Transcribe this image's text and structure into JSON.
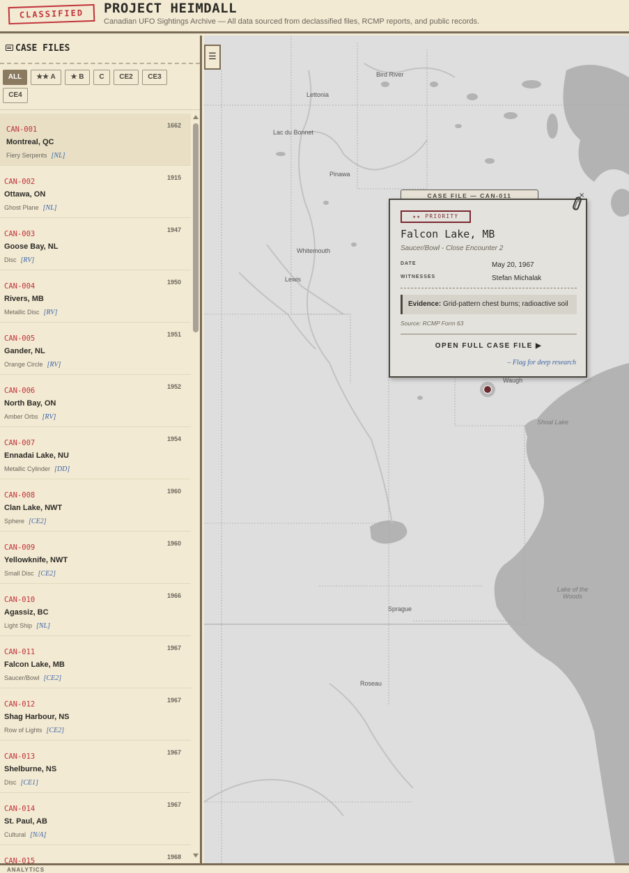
{
  "header": {
    "stamp": "CLASSIFIED",
    "title": "PROJECT HEIMDALL",
    "subtitle": "Canadian UFO Sightings Archive — All data sourced from declassified files, RCMP reports, and public records."
  },
  "sidebar": {
    "title": "CASE FILES",
    "filters": [
      "ALL",
      "★★ A",
      "★ B",
      "C",
      "CE2",
      "CE3",
      "CE4"
    ],
    "active_filter": "ALL",
    "cases": [
      {
        "code": "CAN-001",
        "year": "1662",
        "location": "Montreal, QC",
        "shape": "Fiery Serpents",
        "classification": "[NL]"
      },
      {
        "code": "CAN-002",
        "year": "1915",
        "location": "Ottawa, ON",
        "shape": "Ghost Plane",
        "classification": "[NL]"
      },
      {
        "code": "CAN-003",
        "year": "1947",
        "location": "Goose Bay, NL",
        "shape": "Disc",
        "classification": "[RV]"
      },
      {
        "code": "CAN-004",
        "year": "1950",
        "location": "Rivers, MB",
        "shape": "Metallic Disc",
        "classification": "[RV]"
      },
      {
        "code": "CAN-005",
        "year": "1951",
        "location": "Gander, NL",
        "shape": "Orange Circle",
        "classification": "[RV]"
      },
      {
        "code": "CAN-006",
        "year": "1952",
        "location": "North Bay, ON",
        "shape": "Amber Orbs",
        "classification": "[RV]"
      },
      {
        "code": "CAN-007",
        "year": "1954",
        "location": "Ennadai Lake, NU",
        "shape": "Metallic Cylinder",
        "classification": "[DD]"
      },
      {
        "code": "CAN-008",
        "year": "1960",
        "location": "Clan Lake, NWT",
        "shape": "Sphere",
        "classification": "[CE2]"
      },
      {
        "code": "CAN-009",
        "year": "1960",
        "location": "Yellowknife, NWT",
        "shape": "Small Disc",
        "classification": "[CE2]"
      },
      {
        "code": "CAN-010",
        "year": "1966",
        "location": "Agassiz, BC",
        "shape": "Light Ship",
        "classification": "[NL]"
      },
      {
        "code": "CAN-011",
        "year": "1967",
        "location": "Falcon Lake, MB",
        "shape": "Saucer/Bowl",
        "classification": "[CE2]"
      },
      {
        "code": "CAN-012",
        "year": "1967",
        "location": "Shag Harbour, NS",
        "shape": "Row of Lights",
        "classification": "[CE2]"
      },
      {
        "code": "CAN-013",
        "year": "1967",
        "location": "Shelburne, NS",
        "shape": "Disc",
        "classification": "[CE1]"
      },
      {
        "code": "CAN-014",
        "year": "1967",
        "location": "St. Paul, AB",
        "shape": "Cultural",
        "classification": "[N/A]"
      },
      {
        "code": "CAN-015",
        "year": "1968",
        "location": "",
        "shape": "",
        "classification": ""
      }
    ]
  },
  "map": {
    "toggle_icon": "☰",
    "labels": {
      "bird_river": "Bird River",
      "lettonia": "Lettonia",
      "lac_du_bonnet": "Lac du Bonnet",
      "pinawa": "Pinawa",
      "whitemouth": "Whitemouth",
      "lewis": "Lewis",
      "waugh": "Waugh",
      "shoal_lake": "Shoal Lake",
      "lake_of_the_woods": "Lake of the Woods",
      "sprague": "Sprague",
      "roseau": "Roseau"
    }
  },
  "popup": {
    "tab": "CASE FILE — CAN-011",
    "priority": "★★ PRIORITY",
    "location": "Falcon Lake, MB",
    "type": "Saucer/Bowl - Close Encounter 2",
    "date_label": "DATE",
    "date": "May 20, 1967",
    "witnesses_label": "WITNESSES",
    "witnesses": "Stefan Michalak",
    "evidence_label": "Evidence:",
    "evidence": "Grid-pattern chest burns; radioactive soil",
    "source": "Source: RCMP Form 63",
    "open_button": "OPEN FULL CASE FILE ▶",
    "flag_link": "– Flag for deep research",
    "close": "×"
  },
  "footer": {
    "text": "ANALYTICS"
  },
  "colors": {
    "paper": "#f3ead3",
    "stamp_red": "#c0323a",
    "border": "#7a6b55",
    "class_blue": "#3a64a8",
    "marker": "#6b2a2e"
  }
}
